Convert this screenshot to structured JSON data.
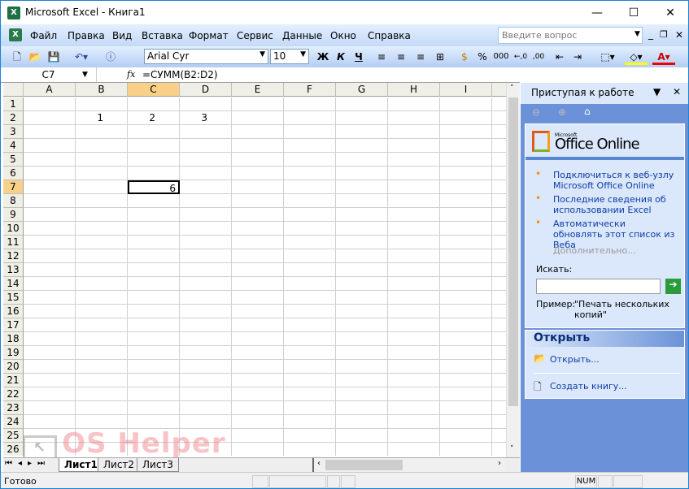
{
  "window": {
    "title": "Microsoft Excel - Книга1"
  },
  "menu": [
    "Файл",
    "Правка",
    "Вид",
    "Вставка",
    "Формат",
    "Сервис",
    "Данные",
    "Окно",
    "Справка"
  ],
  "ask_placeholder": "Введите вопрос",
  "toolbar": {
    "font": "Arial Cyr",
    "size": "10",
    "bold": "Ж",
    "italic": "К",
    "underline": "Ч",
    "percent": "%",
    "thousands": "000"
  },
  "formula_bar": {
    "name_box": "C7",
    "fx": "fx",
    "formula": "=СУММ(B2:D2)"
  },
  "columns": [
    "A",
    "B",
    "C",
    "D",
    "E",
    "F",
    "G",
    "H",
    "I"
  ],
  "rows": [
    "1",
    "2",
    "3",
    "4",
    "5",
    "6",
    "7",
    "8",
    "9",
    "10",
    "11",
    "12",
    "13",
    "14",
    "15",
    "16",
    "17",
    "18",
    "19",
    "20",
    "21",
    "22",
    "23",
    "24",
    "25",
    "26"
  ],
  "cells": [
    {
      "ref": "B2",
      "value": "1"
    },
    {
      "ref": "C2",
      "value": "2"
    },
    {
      "ref": "D2",
      "value": "3"
    },
    {
      "ref": "C7",
      "value": "6"
    }
  ],
  "sheets": [
    "Лист1",
    "Лист2",
    "Лист3"
  ],
  "status": {
    "text": "Готово",
    "num": "NUM"
  },
  "task_pane": {
    "title": "Приступая к работе",
    "logo_small": "Microsoft",
    "logo": "Office Online",
    "links": [
      "Подключиться к веб-узлу Microsoft Office Online",
      "Последние сведения об использовании Excel",
      "Автоматически обновлять этот список из Веба"
    ],
    "more": "Дополнительно...",
    "search_label": "Искать:",
    "example_label": "Пример:",
    "example": "\"Печать нескольких копий\"",
    "open_header": "Открыть",
    "open_link": "Открыть...",
    "new_link": "Создать книгу..."
  },
  "watermark": "OS Helper"
}
